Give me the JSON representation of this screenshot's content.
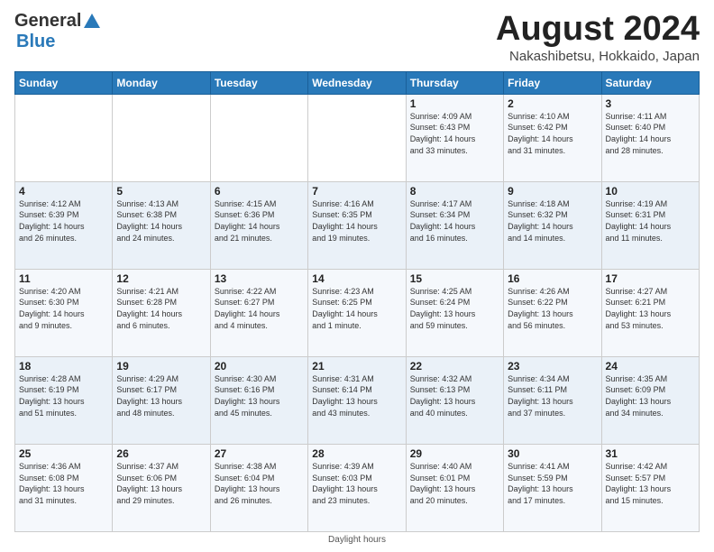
{
  "header": {
    "logo_general": "General",
    "logo_blue": "Blue",
    "title": "August 2024",
    "subtitle": "Nakashibetsu, Hokkaido, Japan"
  },
  "calendar": {
    "days": [
      "Sunday",
      "Monday",
      "Tuesday",
      "Wednesday",
      "Thursday",
      "Friday",
      "Saturday"
    ],
    "weeks": [
      [
        {
          "day": "",
          "info": ""
        },
        {
          "day": "",
          "info": ""
        },
        {
          "day": "",
          "info": ""
        },
        {
          "day": "",
          "info": ""
        },
        {
          "day": "1",
          "info": "Sunrise: 4:09 AM\nSunset: 6:43 PM\nDaylight: 14 hours\nand 33 minutes."
        },
        {
          "day": "2",
          "info": "Sunrise: 4:10 AM\nSunset: 6:42 PM\nDaylight: 14 hours\nand 31 minutes."
        },
        {
          "day": "3",
          "info": "Sunrise: 4:11 AM\nSunset: 6:40 PM\nDaylight: 14 hours\nand 28 minutes."
        }
      ],
      [
        {
          "day": "4",
          "info": "Sunrise: 4:12 AM\nSunset: 6:39 PM\nDaylight: 14 hours\nand 26 minutes."
        },
        {
          "day": "5",
          "info": "Sunrise: 4:13 AM\nSunset: 6:38 PM\nDaylight: 14 hours\nand 24 minutes."
        },
        {
          "day": "6",
          "info": "Sunrise: 4:15 AM\nSunset: 6:36 PM\nDaylight: 14 hours\nand 21 minutes."
        },
        {
          "day": "7",
          "info": "Sunrise: 4:16 AM\nSunset: 6:35 PM\nDaylight: 14 hours\nand 19 minutes."
        },
        {
          "day": "8",
          "info": "Sunrise: 4:17 AM\nSunset: 6:34 PM\nDaylight: 14 hours\nand 16 minutes."
        },
        {
          "day": "9",
          "info": "Sunrise: 4:18 AM\nSunset: 6:32 PM\nDaylight: 14 hours\nand 14 minutes."
        },
        {
          "day": "10",
          "info": "Sunrise: 4:19 AM\nSunset: 6:31 PM\nDaylight: 14 hours\nand 11 minutes."
        }
      ],
      [
        {
          "day": "11",
          "info": "Sunrise: 4:20 AM\nSunset: 6:30 PM\nDaylight: 14 hours\nand 9 minutes."
        },
        {
          "day": "12",
          "info": "Sunrise: 4:21 AM\nSunset: 6:28 PM\nDaylight: 14 hours\nand 6 minutes."
        },
        {
          "day": "13",
          "info": "Sunrise: 4:22 AM\nSunset: 6:27 PM\nDaylight: 14 hours\nand 4 minutes."
        },
        {
          "day": "14",
          "info": "Sunrise: 4:23 AM\nSunset: 6:25 PM\nDaylight: 14 hours\nand 1 minute."
        },
        {
          "day": "15",
          "info": "Sunrise: 4:25 AM\nSunset: 6:24 PM\nDaylight: 13 hours\nand 59 minutes."
        },
        {
          "day": "16",
          "info": "Sunrise: 4:26 AM\nSunset: 6:22 PM\nDaylight: 13 hours\nand 56 minutes."
        },
        {
          "day": "17",
          "info": "Sunrise: 4:27 AM\nSunset: 6:21 PM\nDaylight: 13 hours\nand 53 minutes."
        }
      ],
      [
        {
          "day": "18",
          "info": "Sunrise: 4:28 AM\nSunset: 6:19 PM\nDaylight: 13 hours\nand 51 minutes."
        },
        {
          "day": "19",
          "info": "Sunrise: 4:29 AM\nSunset: 6:17 PM\nDaylight: 13 hours\nand 48 minutes."
        },
        {
          "day": "20",
          "info": "Sunrise: 4:30 AM\nSunset: 6:16 PM\nDaylight: 13 hours\nand 45 minutes."
        },
        {
          "day": "21",
          "info": "Sunrise: 4:31 AM\nSunset: 6:14 PM\nDaylight: 13 hours\nand 43 minutes."
        },
        {
          "day": "22",
          "info": "Sunrise: 4:32 AM\nSunset: 6:13 PM\nDaylight: 13 hours\nand 40 minutes."
        },
        {
          "day": "23",
          "info": "Sunrise: 4:34 AM\nSunset: 6:11 PM\nDaylight: 13 hours\nand 37 minutes."
        },
        {
          "day": "24",
          "info": "Sunrise: 4:35 AM\nSunset: 6:09 PM\nDaylight: 13 hours\nand 34 minutes."
        }
      ],
      [
        {
          "day": "25",
          "info": "Sunrise: 4:36 AM\nSunset: 6:08 PM\nDaylight: 13 hours\nand 31 minutes."
        },
        {
          "day": "26",
          "info": "Sunrise: 4:37 AM\nSunset: 6:06 PM\nDaylight: 13 hours\nand 29 minutes."
        },
        {
          "day": "27",
          "info": "Sunrise: 4:38 AM\nSunset: 6:04 PM\nDaylight: 13 hours\nand 26 minutes."
        },
        {
          "day": "28",
          "info": "Sunrise: 4:39 AM\nSunset: 6:03 PM\nDaylight: 13 hours\nand 23 minutes."
        },
        {
          "day": "29",
          "info": "Sunrise: 4:40 AM\nSunset: 6:01 PM\nDaylight: 13 hours\nand 20 minutes."
        },
        {
          "day": "30",
          "info": "Sunrise: 4:41 AM\nSunset: 5:59 PM\nDaylight: 13 hours\nand 17 minutes."
        },
        {
          "day": "31",
          "info": "Sunrise: 4:42 AM\nSunset: 5:57 PM\nDaylight: 13 hours\nand 15 minutes."
        }
      ]
    ]
  },
  "footer": {
    "note": "Daylight hours"
  }
}
